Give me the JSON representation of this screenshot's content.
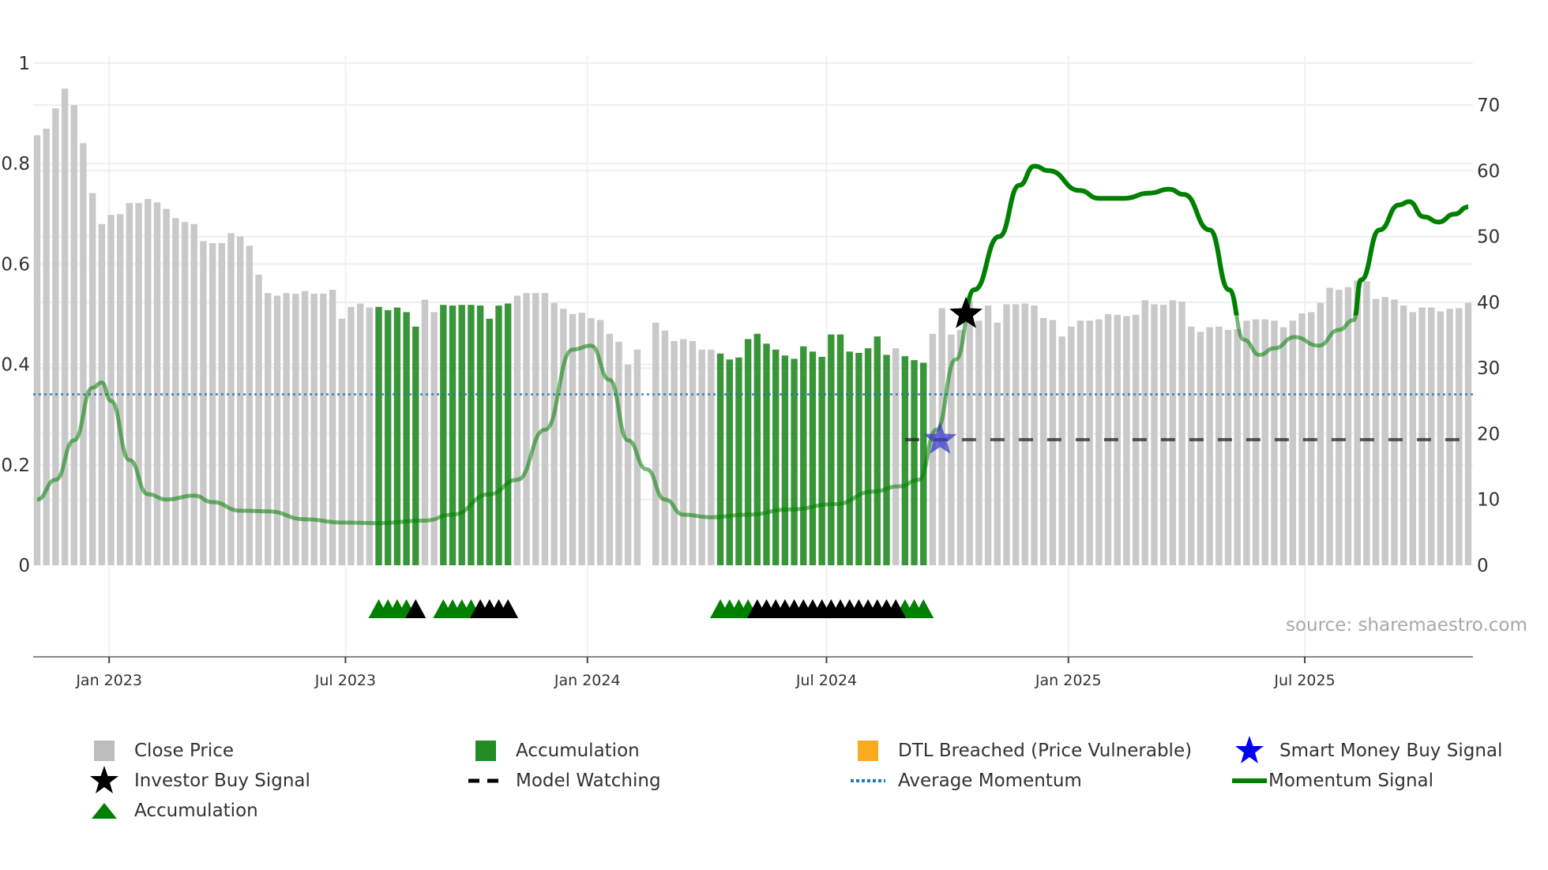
{
  "chart_data": {
    "type": "bar+line",
    "source": "source: sharemaestro.com",
    "left_axis": {
      "ticks": [
        0,
        0.2,
        0.4,
        0.6,
        0.8,
        1
      ],
      "labels": [
        "0",
        "0.2",
        "0.4",
        "0.6",
        "0.8",
        "1"
      ],
      "range": [
        0,
        1
      ]
    },
    "right_axis": {
      "ticks": [
        0,
        10,
        20,
        30,
        40,
        50,
        60,
        70
      ],
      "labels": [
        "0",
        "10",
        "20",
        "30",
        "40",
        "50",
        "60",
        "70"
      ],
      "range": [
        0,
        70
      ]
    },
    "x_ticks": [
      {
        "label": "Jan 2023",
        "at": 7.8
      },
      {
        "label": "Jul 2023",
        "at": 33.4
      },
      {
        "label": "Jan 2024",
        "at": 59.6
      },
      {
        "label": "Jul 2024",
        "at": 85.5
      },
      {
        "label": "Jan 2025",
        "at": 111.7
      },
      {
        "label": "Jul 2025",
        "at": 137.3
      }
    ],
    "close_price": [
      65.4,
      66.4,
      69.5,
      72.5,
      70,
      64.2,
      56.6,
      51.9,
      53.3,
      53.4,
      55.1,
      55.1,
      55.7,
      55.2,
      54.2,
      52.8,
      52.2,
      51.9,
      49.3,
      49,
      49,
      50.5,
      50,
      48.6,
      44.2,
      41.4,
      41,
      41.4,
      41.3,
      41.7,
      41.3,
      41.3,
      41.9,
      37.5,
      39.3,
      39.8,
      39.2,
      39.3,
      38.8,
      39.2,
      38.5,
      36.3,
      40.4,
      38.5,
      39.6,
      39.5,
      39.6,
      39.6,
      39.5,
      37.5,
      39.5,
      39.8,
      41,
      41.4,
      41.4,
      41.4,
      39.9,
      39,
      38.2,
      38.4,
      37.6,
      37.3,
      35.2,
      34,
      30.5,
      32.8,
      null,
      36.9,
      35.7,
      34.1,
      34.4,
      34.1,
      32.8,
      32.8,
      32.2,
      31.3,
      31.6,
      34.4,
      35.2,
      33.7,
      32.8,
      31.9,
      31.4,
      33.3,
      32.5,
      31.7,
      35.1,
      35.1,
      32.5,
      32.3,
      33,
      34.8,
      32,
      33,
      31.8,
      31.2,
      30.8,
      35.2,
      39.1,
      35.1,
      35.8,
      40.2,
      37.2,
      39.5,
      36.9,
      39.7,
      39.7,
      39.8,
      39.5,
      37.6,
      37.3,
      34.8,
      36.3,
      37.2,
      37.2,
      37.4,
      38.2,
      38.1,
      37.9,
      38.1,
      40.3,
      39.7,
      39.6,
      40.3,
      40.1,
      36.3,
      35.5,
      36.2,
      36.3,
      35.8,
      35.9,
      37.2,
      37.4,
      37.4,
      37.2,
      36.2,
      37.2,
      38.3,
      38.5,
      39.9,
      42.2,
      41.9,
      42.3,
      43.3,
      43.2,
      40.5,
      40.8,
      40.4,
      39.5,
      38.5,
      39.2,
      39.2,
      38.6,
      39,
      39.1,
      39.9
    ],
    "accumulation_bar_ranges": [
      [
        37,
        41
      ],
      [
        44,
        51
      ],
      [
        74,
        92
      ],
      [
        94,
        96
      ]
    ],
    "momentum_signal": [
      [
        0,
        10
      ],
      [
        2,
        13
      ],
      [
        4,
        19
      ],
      [
        6,
        27
      ],
      [
        7,
        27.8
      ],
      [
        8,
        25
      ],
      [
        10,
        16
      ],
      [
        12,
        10.8
      ],
      [
        14,
        10
      ],
      [
        17,
        10.6
      ],
      [
        19,
        9.6
      ],
      [
        22,
        8.3
      ],
      [
        25,
        8.2
      ],
      [
        29,
        7
      ],
      [
        33,
        6.5
      ],
      [
        37,
        6.4
      ],
      [
        42,
        6.8
      ],
      [
        45,
        7.7
      ],
      [
        49,
        10.8
      ],
      [
        52,
        13
      ],
      [
        55,
        20.6
      ],
      [
        58,
        32.8
      ],
      [
        60,
        33.4
      ],
      [
        62,
        28.2
      ],
      [
        64,
        19
      ],
      [
        66,
        14.6
      ],
      [
        68,
        10
      ],
      [
        70,
        7.7
      ],
      [
        73,
        7.3
      ],
      [
        77,
        7.7
      ],
      [
        81.5,
        8.5
      ],
      [
        86.5,
        9.3
      ],
      [
        90.5,
        11.2
      ],
      [
        93.4,
        12
      ],
      [
        95.5,
        13
      ],
      [
        97.4,
        20.6
      ],
      [
        99.5,
        31.3
      ],
      [
        101.5,
        41.9
      ],
      [
        104.2,
        50
      ],
      [
        106.4,
        57.8
      ],
      [
        108,
        60.7
      ],
      [
        109.6,
        60
      ],
      [
        112.9,
        57
      ],
      [
        115,
        55.8
      ],
      [
        117.7,
        55.8
      ],
      [
        120.5,
        56.6
      ],
      [
        122.6,
        57.2
      ],
      [
        124.2,
        56.4
      ],
      [
        127,
        51
      ],
      [
        129.1,
        41.9
      ],
      [
        130.7,
        34.3
      ],
      [
        132.4,
        32
      ],
      [
        134,
        33
      ],
      [
        136.2,
        34.7
      ],
      [
        138.8,
        33.4
      ],
      [
        141,
        35.8
      ],
      [
        142.6,
        37.3
      ],
      [
        143.4,
        43.4
      ],
      [
        145.4,
        51
      ],
      [
        147.5,
        54.8
      ],
      [
        148.6,
        55.3
      ],
      [
        150.2,
        53
      ],
      [
        151.8,
        52.2
      ],
      [
        153.5,
        53.4
      ],
      [
        155,
        54.5
      ]
    ],
    "average_momentum": 26,
    "model_watching": {
      "level": 19.1,
      "from": 94,
      "to": 155.5
    },
    "investor_buy_signal": {
      "at": 100.6,
      "value": 38.2
    },
    "smart_money_buy_signal": {
      "at": 97.8,
      "value": 19.1
    },
    "signal_triangles": {
      "green": [
        37,
        38,
        39,
        40,
        44,
        45,
        46,
        47,
        74,
        75,
        76,
        77,
        94,
        95,
        96
      ],
      "black": [
        41,
        48,
        49,
        50,
        51,
        78,
        79,
        80,
        81,
        82,
        83,
        84,
        85,
        86,
        87,
        88,
        89,
        90,
        91,
        92,
        93
      ]
    },
    "colors": {
      "close": "#c9c9c9",
      "accumulation": "#228b22",
      "momentum": "#008000",
      "average": "#1f77b4",
      "dtl": "#fbab1f",
      "smart": "#0000ff",
      "investor": "#000000"
    }
  },
  "legend": {
    "close_price": "Close Price",
    "accumulation_bar": "Accumulation",
    "dtl": "DTL Breached (Price Vulnerable)",
    "smart_money": "Smart Money Buy Signal",
    "investor_buy": "Investor Buy Signal",
    "model_watching": "Model Watching",
    "average_momentum": "Average Momentum",
    "momentum_signal": "Momentum Signal",
    "accumulation_triangle": "Accumulation"
  }
}
